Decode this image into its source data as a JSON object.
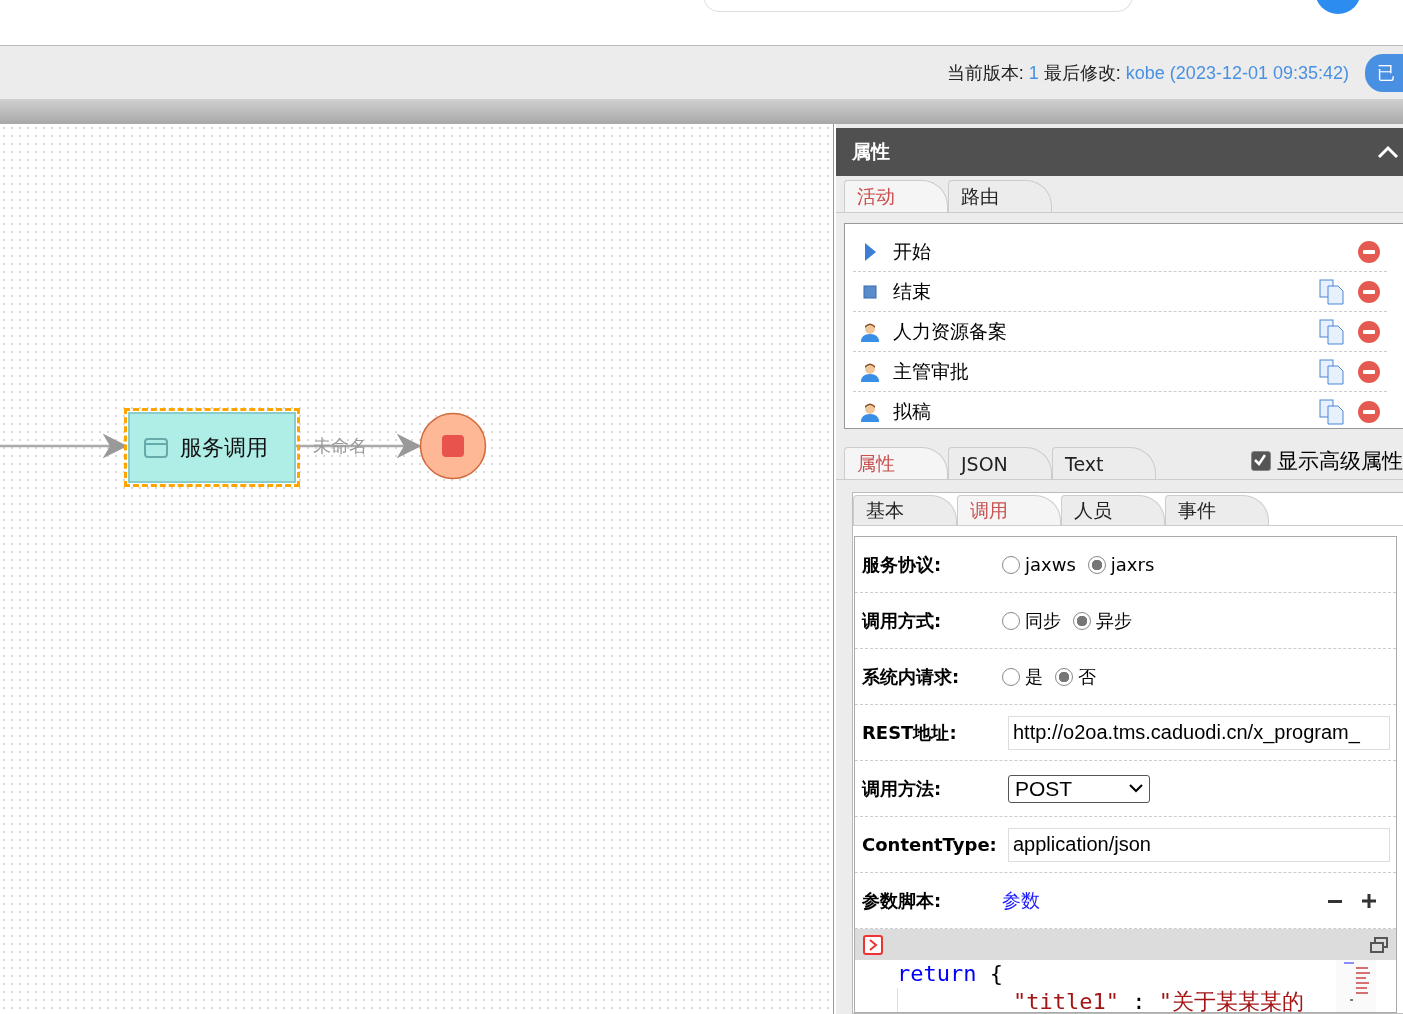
{
  "version_bar": {
    "version_label": "当前版本:",
    "version": "1",
    "modified_label": "最后修改:",
    "modified": "kobe (2023-12-01 09:35:42)",
    "button": "已"
  },
  "diagram": {
    "nodes": [
      {
        "kind": "activity",
        "label": "服务调用",
        "selected": true
      },
      {
        "kind": "end"
      }
    ],
    "edge_label": "未命名"
  },
  "panel": {
    "title": "属性",
    "expanded": true,
    "list_tabs": [
      {
        "label": "活动",
        "selected": true
      },
      {
        "label": "路由",
        "selected": false
      }
    ],
    "activities": [
      {
        "kind": "start",
        "name": "开始",
        "copyable": false
      },
      {
        "kind": "end",
        "name": "结束",
        "copyable": true
      },
      {
        "kind": "manual",
        "name": "人力资源备案",
        "copyable": true
      },
      {
        "kind": "manual",
        "name": "主管审批",
        "copyable": true
      },
      {
        "kind": "manual",
        "name": "拟稿",
        "copyable": true
      }
    ],
    "prop_tabs": [
      {
        "label": "属性",
        "selected": true
      },
      {
        "label": "JSON",
        "selected": false
      },
      {
        "label": "Text",
        "selected": false
      }
    ],
    "show_advanced": {
      "label": "显示高级属性",
      "checked": true
    },
    "sub_tabs": [
      {
        "label": "基本",
        "selected": false
      },
      {
        "label": "调用",
        "selected": true
      },
      {
        "label": "人员",
        "selected": false
      },
      {
        "label": "事件",
        "selected": false
      }
    ],
    "form": [
      {
        "kind": "radio",
        "label": "服务协议:",
        "options": [
          {
            "label": "jaxws",
            "selected": false
          },
          {
            "label": "jaxrs",
            "selected": true
          }
        ]
      },
      {
        "kind": "radio",
        "label": "调用方式:",
        "options": [
          {
            "label": "同步",
            "selected": false
          },
          {
            "label": "异步",
            "selected": true
          }
        ]
      },
      {
        "kind": "radio",
        "label": "系统内请求:",
        "options": [
          {
            "label": "是",
            "selected": false
          },
          {
            "label": "否",
            "selected": true
          }
        ]
      },
      {
        "kind": "input",
        "label": "REST地址:",
        "value": "http://o2oa.tms.caduodi.cn/x_program_"
      },
      {
        "kind": "select",
        "label": "调用方法:",
        "value": "POST"
      },
      {
        "kind": "input",
        "label": "ContentType:",
        "value": "application/json"
      },
      {
        "kind": "script",
        "label": "参数脚本:",
        "link": "参数"
      }
    ],
    "code": {
      "keyword": "return",
      "open": "{",
      "entries": [
        {
          "key": "\"title1\"",
          "sep": ":",
          "value": "\"关于某某某的"
        }
      ]
    }
  }
}
